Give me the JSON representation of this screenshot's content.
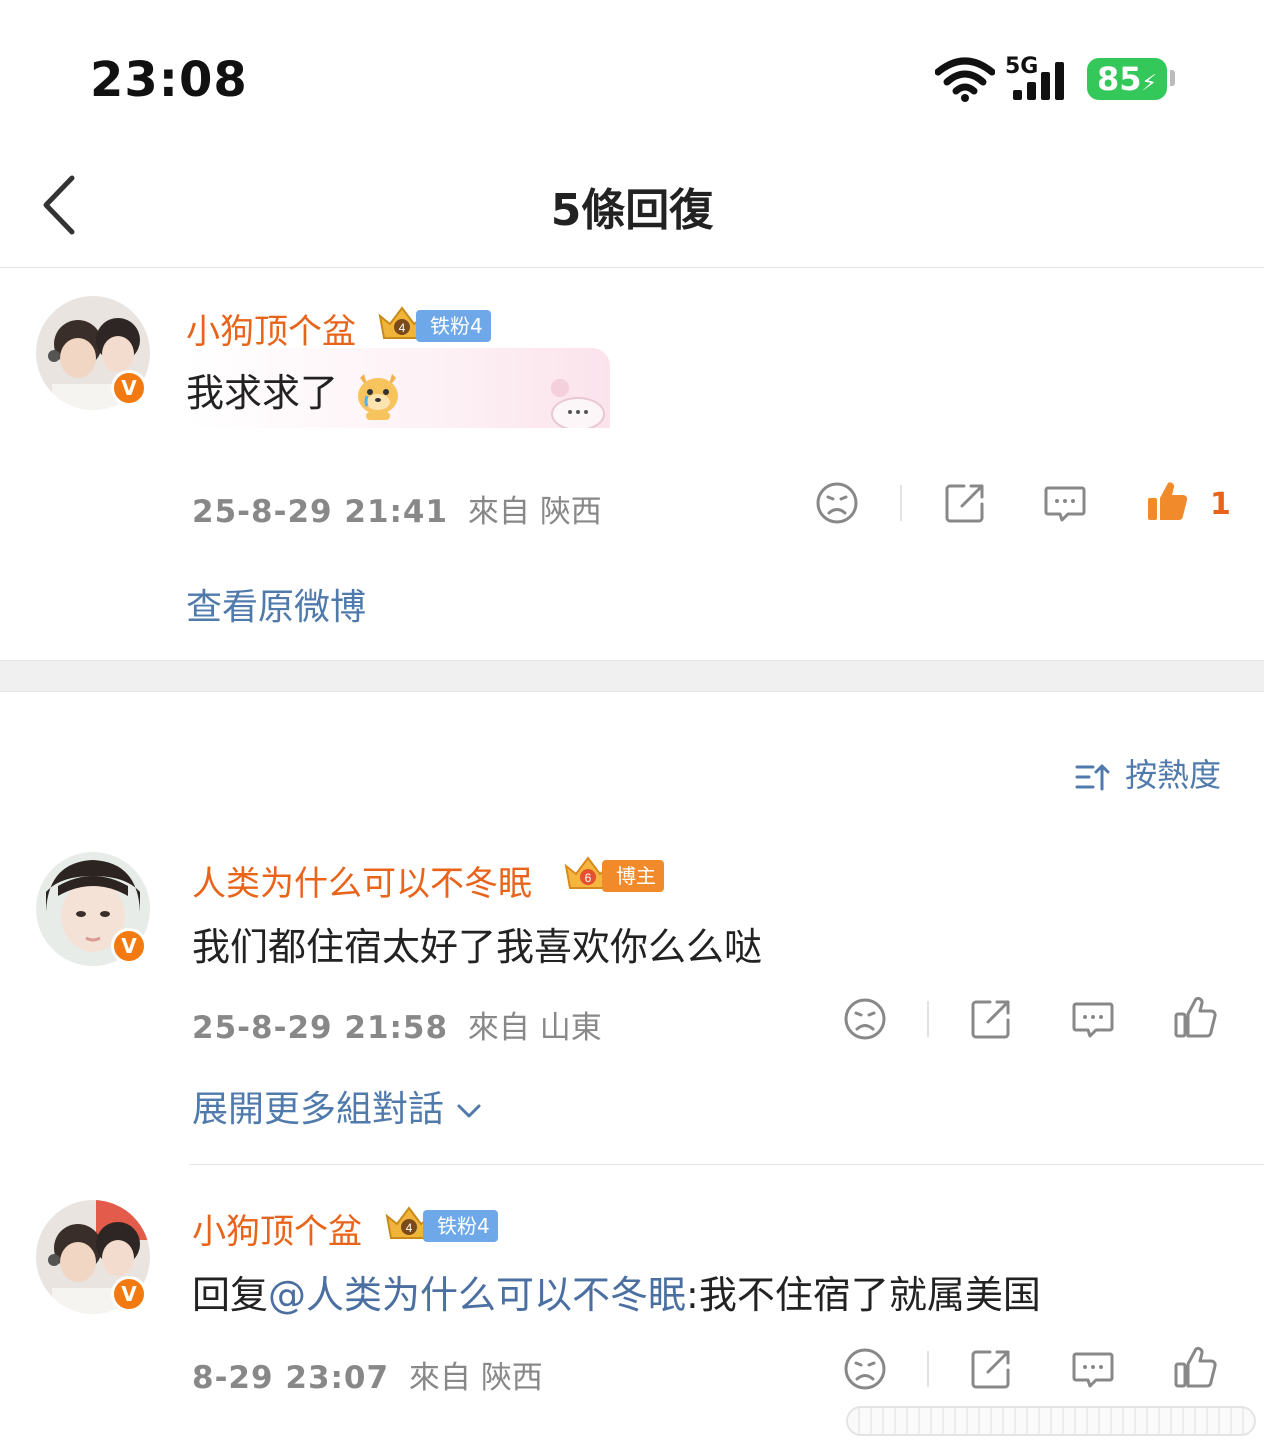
{
  "status_bar": {
    "time": "23:08",
    "network": "5G",
    "battery": "85"
  },
  "nav": {
    "title": "5條回復"
  },
  "root_comment": {
    "user": "小狗顶个盆",
    "fan_badge": "铁粉4",
    "fan_level": "4",
    "text": "我求求了",
    "emoji": "dog-tears-emoji",
    "timestamp": "25-8-29 21:41",
    "location": "來自 陝西",
    "like_count": "1",
    "view_original": "查看原微博"
  },
  "sort": {
    "label": "按熱度"
  },
  "replies": [
    {
      "user": "人类为什么可以不冬眠",
      "badge": "博主",
      "badge_level": "6",
      "text": "我们都住宿太好了我喜欢你么么哒",
      "timestamp": "25-8-29 21:58",
      "location": "來自 山東",
      "expand": "展開更多組對話"
    },
    {
      "user": "小狗顶个盆",
      "badge": "铁粉4",
      "badge_level": "4",
      "reply_prefix": "回复",
      "mention": "@人类为什么可以不冬眠",
      "text": ":我不住宿了就属美国",
      "timestamp": "8-29 23:07",
      "location": "來自 陝西"
    }
  ],
  "colors": {
    "username": "#e8641b",
    "link": "#4f7aab",
    "meta": "#888888",
    "fan_badge": "#6fa8e8",
    "blogger_badge": "#f08a2b",
    "battery": "#34c759"
  }
}
